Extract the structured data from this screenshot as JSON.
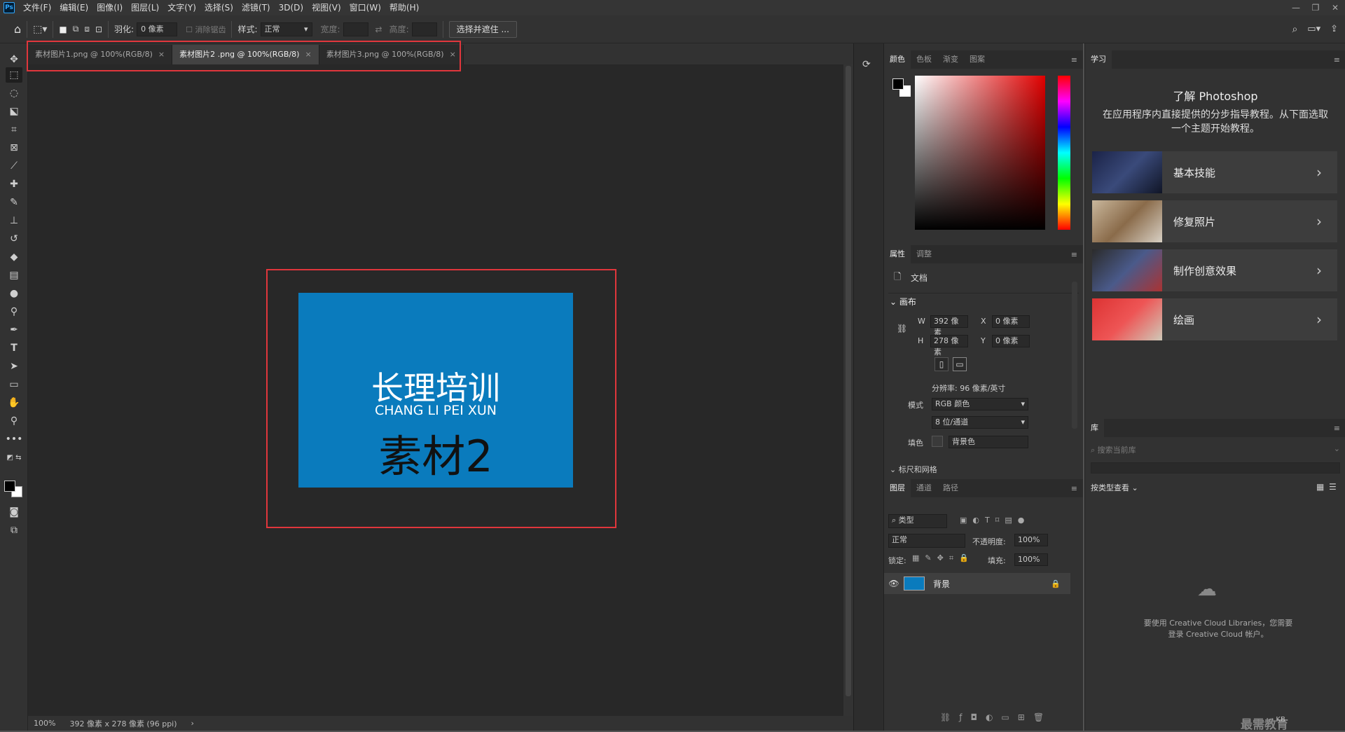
{
  "menubar": {
    "items": [
      "文件(F)",
      "编辑(E)",
      "图像(I)",
      "图层(L)",
      "文字(Y)",
      "选择(S)",
      "滤镜(T)",
      "3D(D)",
      "视图(V)",
      "窗口(W)",
      "帮助(H)"
    ],
    "logo": "Ps"
  },
  "options": {
    "feather_label": "羽化:",
    "feather_value": "0 像素",
    "antialias_label": "消除锯齿",
    "style_label": "样式:",
    "style_value": "正常",
    "width_label": "宽度:",
    "height_label": "高度:",
    "select_mask_label": "选择并遮住 ..."
  },
  "tabs": [
    {
      "label": "素材图片1.png @ 100%(RGB/8)",
      "active": false
    },
    {
      "label": "素材图片2 .png @ 100%(RGB/8)",
      "active": true
    },
    {
      "label": "素材图片3.png @ 100%(RGB/8)",
      "active": false
    }
  ],
  "artboard": {
    "title": "长理培训",
    "subtitle": "CHANG LI PEI XUN",
    "label": "素材2",
    "bg_color": "#0a7bbd"
  },
  "status": {
    "zoom": "100%",
    "doc_info": "392 像素 x 278 像素 (96 ppi)"
  },
  "color_panel": {
    "tabs": [
      "颜色",
      "色板",
      "渐变",
      "图案"
    ]
  },
  "properties": {
    "tabs": [
      "属性",
      "调整"
    ],
    "doc_label": "文档",
    "canvas_label": "画布",
    "w_label": "W",
    "w_value": "392 像素",
    "h_label": "H",
    "h_value": "278 像素",
    "x_label": "X",
    "x_value": "0 像素",
    "y_label": "Y",
    "y_value": "0 像素",
    "resolution": "分辨率: 96 像素/英寸",
    "mode_label": "模式",
    "mode_value": "RGB 颜色",
    "depth_value": "8 位/通道",
    "fill_label": "填色",
    "fill_value": "背景色",
    "rulers_label": "标尺和网格"
  },
  "layers": {
    "tabs": [
      "图层",
      "通道",
      "路径"
    ],
    "filter_placeholder": "类型",
    "blend_mode": "正常",
    "opacity_label": "不透明度:",
    "opacity_value": "100%",
    "lock_label": "锁定:",
    "fill_label": "填充:",
    "fill_value": "100%",
    "layer_name": "背景"
  },
  "learn": {
    "tab": "学习",
    "title": "了解 Photoshop",
    "desc": "在应用程序内直接提供的分步指导教程。从下面选取一个主题开始教程。",
    "cards": [
      "基本技能",
      "修复照片",
      "制作创意效果",
      "绘画"
    ]
  },
  "library": {
    "tab": "库",
    "search_placeholder": "搜索当前库",
    "view_by_type": "按类型查看",
    "cc_message": "要使用 Creative Cloud Libraries，您需要登录 Creative Cloud 帐户。",
    "kb_label": "-- KB"
  },
  "watermark": "最需教育",
  "colors": {
    "accent": "#e0363c",
    "panel": "#323232",
    "canvas": "#282828"
  }
}
